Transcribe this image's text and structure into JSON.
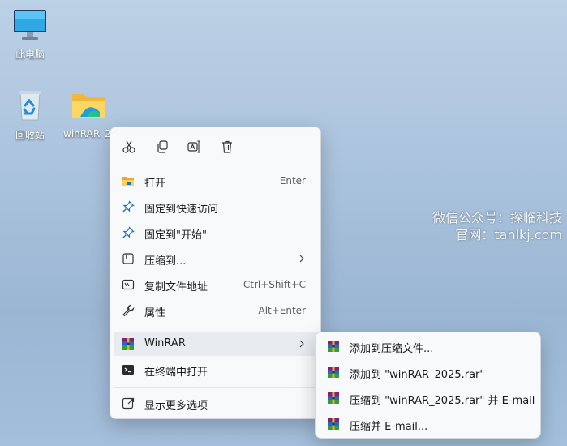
{
  "desktop": {
    "icons": [
      {
        "label": "此电脑"
      },
      {
        "label": "回收站"
      },
      {
        "label": "winRAR_2"
      }
    ]
  },
  "watermark": {
    "line1": "微信公众号：探临科技",
    "line2": "官网：tanlkj.com"
  },
  "context_menu": {
    "toolbar": [
      "cut-icon",
      "copy-icon",
      "rename-icon",
      "delete-icon"
    ],
    "items": [
      {
        "label": "打开",
        "shortcut": "Enter"
      },
      {
        "label": "固定到快速访问",
        "shortcut": ""
      },
      {
        "label": "固定到\"开始\"",
        "shortcut": ""
      },
      {
        "label": "压缩到...",
        "shortcut": ""
      },
      {
        "label": "复制文件地址",
        "shortcut": "Ctrl+Shift+C"
      },
      {
        "label": "属性",
        "shortcut": "Alt+Enter"
      },
      {
        "label": "WinRAR",
        "shortcut": ""
      },
      {
        "label": "在终端中打开",
        "shortcut": ""
      },
      {
        "label": "显示更多选项",
        "shortcut": ""
      }
    ]
  },
  "winrar_submenu": {
    "items": [
      {
        "label": "添加到压缩文件..."
      },
      {
        "label": "添加到 \"winRAR_2025.rar\""
      },
      {
        "label": "压缩到 \"winRAR_2025.rar\" 并 E-mail"
      },
      {
        "label": "压缩并 E-mail..."
      }
    ]
  },
  "colors": {
    "accent": "#0067c0",
    "menu_bg": "#f8f9fb",
    "hover": "#e8ebef"
  }
}
